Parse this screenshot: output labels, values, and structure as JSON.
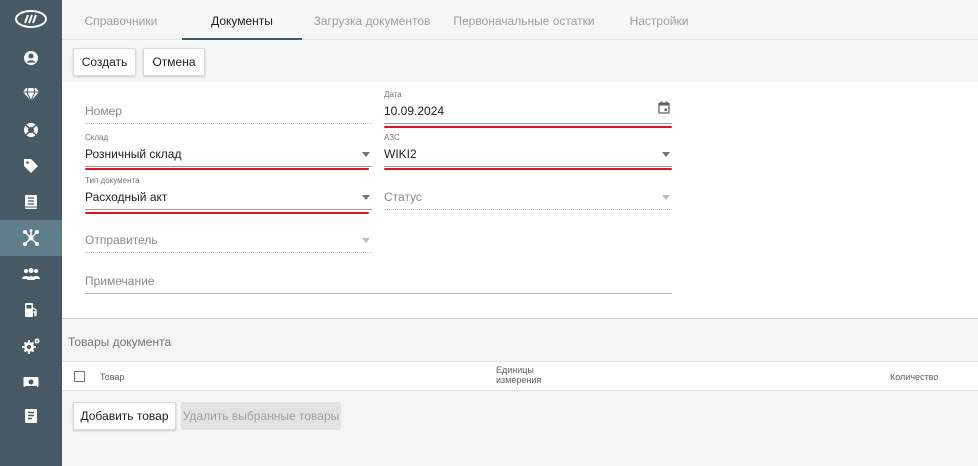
{
  "sidebar": {
    "logo_icon": "brand-logo-icon",
    "items": [
      {
        "icon": "user-icon",
        "active": false
      },
      {
        "icon": "diamond-icon",
        "active": false
      },
      {
        "icon": "lifebuoy-icon",
        "active": false
      },
      {
        "icon": "tag-icon",
        "active": false
      },
      {
        "icon": "book-icon",
        "active": false
      },
      {
        "icon": "network-icon",
        "active": true
      },
      {
        "icon": "users-icon",
        "active": false
      },
      {
        "icon": "fuel-pump-icon",
        "active": false
      },
      {
        "icon": "gears-icon",
        "active": false
      },
      {
        "icon": "money-icon",
        "active": false
      },
      {
        "icon": "list-document-icon",
        "active": false
      }
    ]
  },
  "tabs": [
    {
      "label": "Справочники",
      "active": false
    },
    {
      "label": "Документы",
      "active": true
    },
    {
      "label": "Загрузка документов",
      "active": false
    },
    {
      "label": "Первоначальные остатки",
      "active": false
    },
    {
      "label": "Настройки",
      "active": false
    }
  ],
  "toolbar": {
    "create_label": "Создать",
    "cancel_label": "Отмена"
  },
  "form": {
    "number": {
      "placeholder": "Номер"
    },
    "date": {
      "label": "Дата",
      "value": "10.09.2024"
    },
    "warehouse": {
      "label": "Склад",
      "value": "Розничный склад"
    },
    "station": {
      "label": "АЗС",
      "value": "WIKI2"
    },
    "doc_type": {
      "label": "Тип документа",
      "value": "Расходный акт"
    },
    "status": {
      "placeholder": "Статус"
    },
    "sender": {
      "placeholder": "Отправитель"
    },
    "note": {
      "placeholder": "Примечание"
    }
  },
  "goods": {
    "title": "Товары документа",
    "columns": {
      "product": "Товар",
      "units_line1": "Единицы",
      "units_line2": "измерения",
      "quantity": "Количество"
    },
    "add_label": "Добавить товар",
    "delete_selected_label": "Удалить выбранные товары"
  },
  "colors": {
    "sidebar_bg": "#455a64",
    "sidebar_active": "#607d8b",
    "highlight_underline": "#e0141e"
  }
}
